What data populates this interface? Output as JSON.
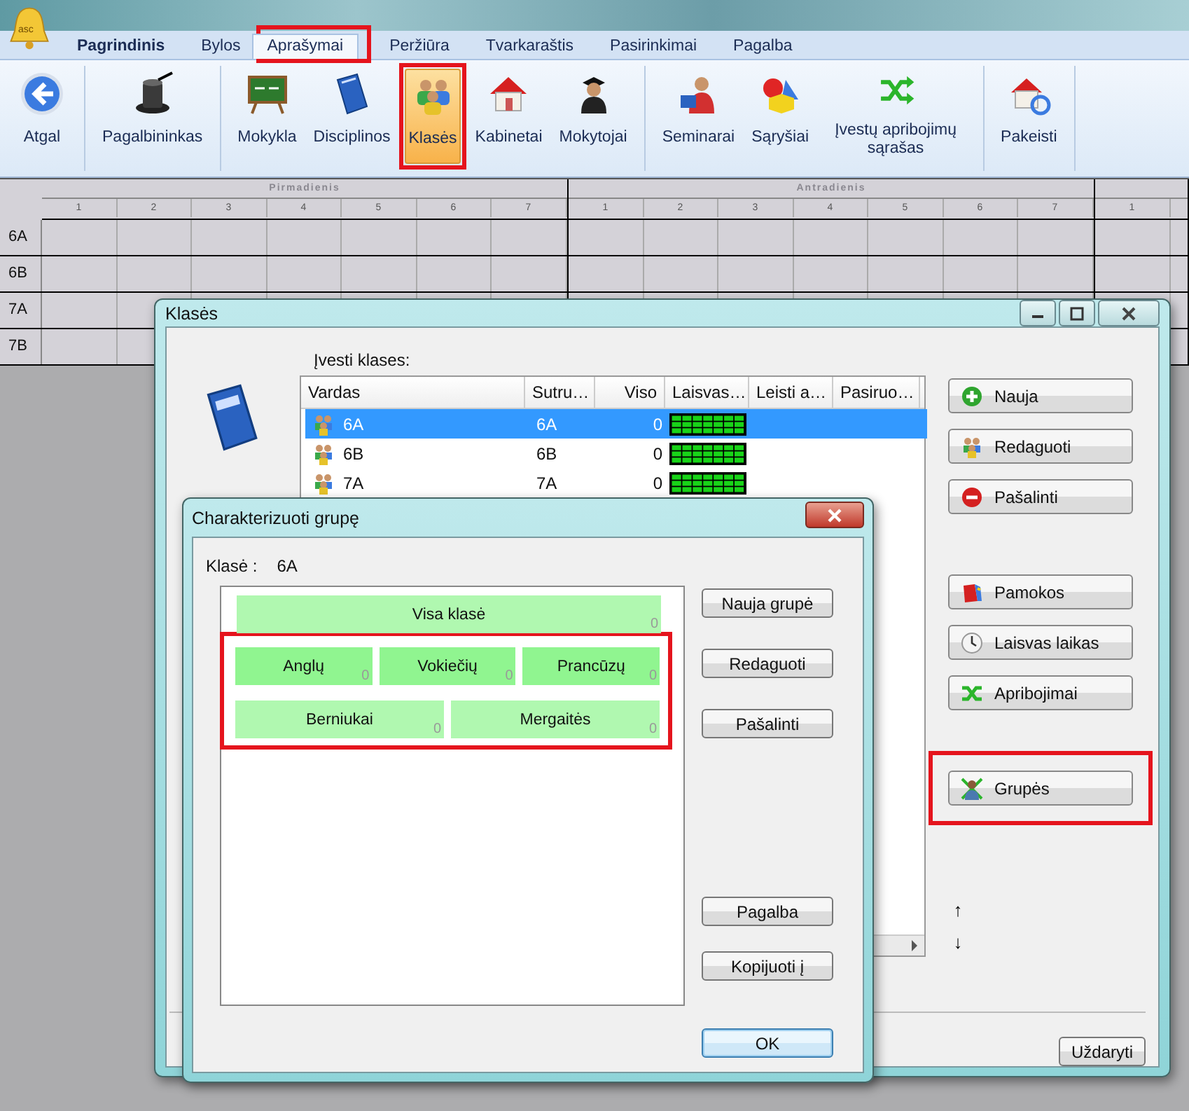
{
  "app": {
    "logo_text": "asc"
  },
  "ribbon": {
    "tabs": [
      {
        "label": "Pagrindinis",
        "kind": "application",
        "selected": false,
        "highlighted": false
      },
      {
        "label": "Bylos",
        "kind": "tab",
        "selected": false,
        "highlighted": false
      },
      {
        "label": "Aprašymai",
        "kind": "tab",
        "selected": true,
        "highlighted": true
      },
      {
        "label": "Peržiūra",
        "kind": "tab",
        "selected": false,
        "highlighted": false
      },
      {
        "label": "Tvarkaraštis",
        "kind": "tab",
        "selected": false,
        "highlighted": false
      },
      {
        "label": "Pasirinkimai",
        "kind": "tab",
        "selected": false,
        "highlighted": false
      },
      {
        "label": "Pagalba",
        "kind": "tab",
        "selected": false,
        "highlighted": false
      }
    ],
    "groups": [
      [
        {
          "label": "Atgal",
          "selected": false,
          "highlighted": false
        }
      ],
      [
        {
          "label": "Pagalbininkas",
          "selected": false,
          "highlighted": false
        }
      ],
      [
        {
          "label": "Mokykla",
          "selected": false,
          "highlighted": false
        },
        {
          "label": "Disciplinos",
          "selected": false,
          "highlighted": false
        },
        {
          "label": "Klasės",
          "selected": true,
          "highlighted": true
        },
        {
          "label": "Kabinetai",
          "selected": false,
          "highlighted": false
        },
        {
          "label": "Mokytojai",
          "selected": false,
          "highlighted": false
        }
      ],
      [
        {
          "label": "Seminarai",
          "selected": false,
          "highlighted": false
        },
        {
          "label": "Sąryšiai",
          "selected": false,
          "highlighted": false
        },
        {
          "label": "Įvestų apribojimų sąrašas",
          "selected": false,
          "highlighted": false
        }
      ],
      [
        {
          "label": "Pakeisti",
          "selected": false,
          "highlighted": false
        }
      ]
    ]
  },
  "timetable": {
    "days": [
      {
        "name": "Pirmadienis",
        "periods": [
          "1",
          "2",
          "3",
          "4",
          "5",
          "6",
          "7"
        ]
      },
      {
        "name": "Antradienis",
        "periods": [
          "1",
          "2",
          "3",
          "4",
          "5",
          "6",
          "7"
        ]
      },
      {
        "periods": [
          "1"
        ]
      }
    ],
    "classes": [
      "6A",
      "6B",
      "7A",
      "7B"
    ]
  },
  "classes_window": {
    "title": "Klasės",
    "list_label": "Įvesti klases:",
    "columns": [
      "Vardas",
      "Sutru…",
      "Viso",
      "Laisvas…",
      "Leisti a…",
      "Pasiruo…"
    ],
    "rows": [
      {
        "name": "6A",
        "short": "6A",
        "total": "0",
        "selected": true
      },
      {
        "name": "6B",
        "short": "6B",
        "total": "0",
        "selected": false
      },
      {
        "name": "7A",
        "short": "7A",
        "total": "0",
        "selected": false
      }
    ],
    "button_groups": [
      [
        {
          "label": "Nauja",
          "highlighted": false
        },
        {
          "label": "Redaguoti",
          "highlighted": false
        },
        {
          "label": "Pašalinti",
          "highlighted": false
        }
      ],
      [
        {
          "label": "Pamokos",
          "highlighted": false
        },
        {
          "label": "Laisvas laikas",
          "highlighted": false
        },
        {
          "label": "Apribojimai",
          "highlighted": false
        }
      ],
      [
        {
          "label": "Grupės",
          "highlighted": true
        }
      ]
    ],
    "move_up": "↑",
    "move_down": "↓",
    "close_button": "Uždaryti"
  },
  "groups_dialog": {
    "title": "Charakterizuoti grupę",
    "class_label": "Klasė :",
    "class_value": "6A",
    "divisions": [
      {
        "highlighted": false,
        "sets": [
          {
            "groups": [
              {
                "name": "Visa klasė",
                "count": "0",
                "color": "#b0f8b0"
              }
            ]
          }
        ]
      },
      {
        "highlighted": true,
        "sets": [
          {
            "groups": [
              {
                "name": "Anglų",
                "count": "0",
                "color": "#90f590"
              },
              {
                "name": "Vokiečių",
                "count": "0",
                "color": "#90f590"
              },
              {
                "name": "Prancūzų",
                "count": "0",
                "color": "#90f590"
              }
            ]
          },
          {
            "groups": [
              {
                "name": "Berniukai",
                "count": "0",
                "color": "#b0f8b0"
              },
              {
                "name": "Mergaitės",
                "count": "0",
                "color": "#b0f8b0"
              }
            ]
          }
        ]
      }
    ],
    "button_groups": [
      [
        {
          "label": "Nauja grupė",
          "kind": "normal"
        },
        {
          "label": "Redaguoti",
          "kind": "normal"
        },
        {
          "label": "Pašalinti",
          "kind": "normal"
        }
      ],
      [
        {
          "label": "Pagalba",
          "kind": "normal"
        },
        {
          "label": "Kopijuoti į",
          "kind": "normal"
        }
      ],
      [
        {
          "label": "OK",
          "kind": "default"
        }
      ]
    ]
  }
}
